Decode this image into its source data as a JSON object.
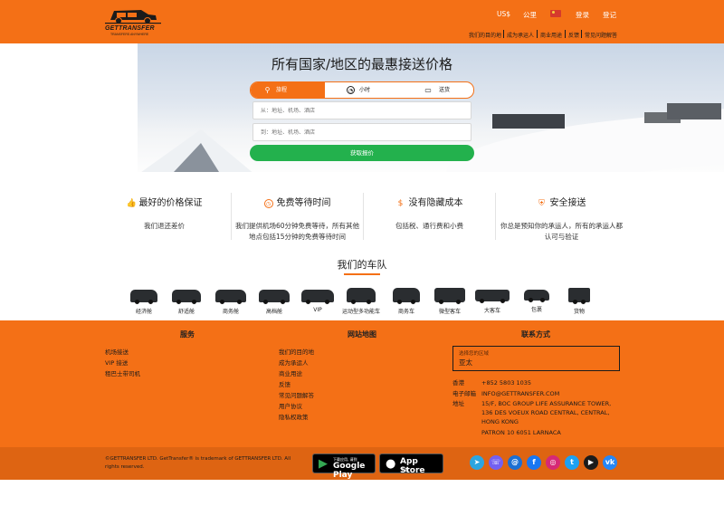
{
  "header": {
    "logo_text": "GETTRANSFER",
    "logo_sub": "TRANSFERS ANYWHERE",
    "currency": "US$",
    "units": "公里",
    "login": "登录",
    "register": "登记",
    "nav": [
      "我们的目的地",
      "成为承运人",
      "商业用途",
      "反馈",
      "常见问题解答"
    ]
  },
  "hero": {
    "title": "所有国家/地区的最惠接送价格",
    "tabs": [
      {
        "label": "旅程",
        "icon": "route-icon",
        "active": true
      },
      {
        "label": "小时",
        "icon": "clock-icon",
        "active": false
      },
      {
        "label": "送货",
        "icon": "van-icon",
        "active": false
      }
    ],
    "from_placeholder": "从：地址、机场、酒店",
    "to_placeholder": "到：地址、机场、酒店",
    "cta": "获取报价"
  },
  "features": [
    {
      "icon": "thumbs-up-icon",
      "title": "最好的价格保证",
      "desc": "我们退还差价"
    },
    {
      "icon": "timer-icon",
      "title": "免费等待时间",
      "desc": "我们提供机场60分钟免费等待，所有其他地点包括15分钟的免费等待时间"
    },
    {
      "icon": "dollar-icon",
      "title": "没有隐藏成本",
      "desc": "包括税、通行费和小费"
    },
    {
      "icon": "shield-icon",
      "title": "安全接送",
      "desc": "你总是预知你的承运人，所有的承运人都认可与验证"
    }
  ],
  "fleet": {
    "title": "我们的车队",
    "cars": [
      "经济舱",
      "舒适舱",
      "商务舱",
      "高档舱",
      "VIP",
      "运动型多功能车",
      "商务车",
      "微型客车",
      "大客车",
      "包裹",
      "货物"
    ]
  },
  "footer": {
    "services_title": "服务",
    "services": [
      "机场接送",
      "VIP 接送",
      "租巴士带司机"
    ],
    "sitemap_title": "网站地图",
    "sitemap": [
      "我们的目的地",
      "成为承运人",
      "商业用途",
      "反馈",
      "常见问题解答",
      "用户协议",
      "隐私权政策"
    ],
    "contact_title": "联系方式",
    "region_label": "选择您的区域",
    "region_value": "亚太",
    "contacts": [
      {
        "label": "香港",
        "value": "+852 5803 1035"
      },
      {
        "label": "电子邮箱",
        "value": "INFO@GETTRANSFER.COM"
      },
      {
        "label": "地址",
        "value": "15/F, BOC GROUP LIFE ASSURANCE TOWER, 136 DES VOEUX ROAD CENTRAL, CENTRAL, HONG KONG"
      }
    ],
    "patron": "PATRON 10 6051 LARNACA"
  },
  "bottom": {
    "copyright": "©GETTRANSFER LTD. GetTransfer® is trademark of GETTRANSFER LTD. All rights reserved.",
    "google_small": "下载应用, 请到",
    "google_big": "Google Play",
    "apple_big": "App Store",
    "apple_small": "下载",
    "social": [
      "telegram-icon",
      "viber-icon",
      "at-icon",
      "facebook-icon",
      "instagram-icon",
      "twitter-icon",
      "youtube-icon",
      "vk-icon"
    ]
  },
  "colors": {
    "brand": "#f47016",
    "cta": "#23b14d"
  }
}
